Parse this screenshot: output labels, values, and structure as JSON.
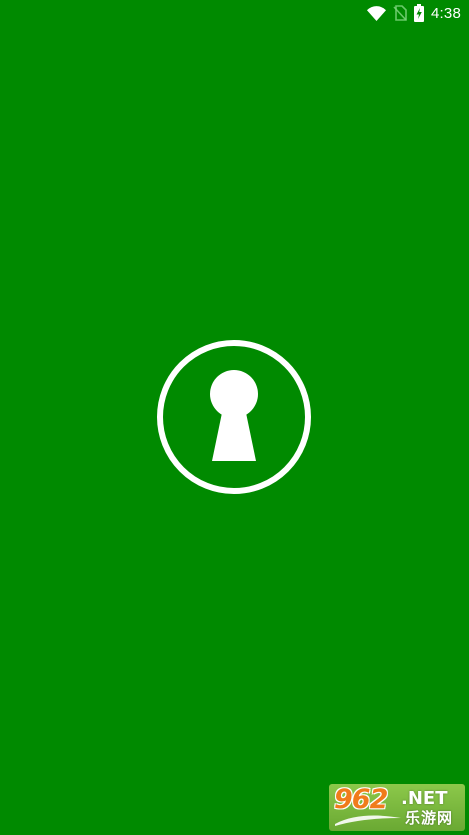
{
  "colors": {
    "background": "#008a00",
    "foreground": "#ffffff",
    "watermark_bg": "#7fbf3f",
    "watermark_number": "#f07c1b"
  },
  "status_bar": {
    "time": "4:38",
    "icons": [
      "wifi-icon",
      "no-sim-icon",
      "battery-charging-icon"
    ]
  },
  "splash": {
    "logo_icon": "keyhole-icon"
  },
  "watermark": {
    "number": "962",
    "domain": ".NET",
    "cn_text": "乐游网"
  }
}
